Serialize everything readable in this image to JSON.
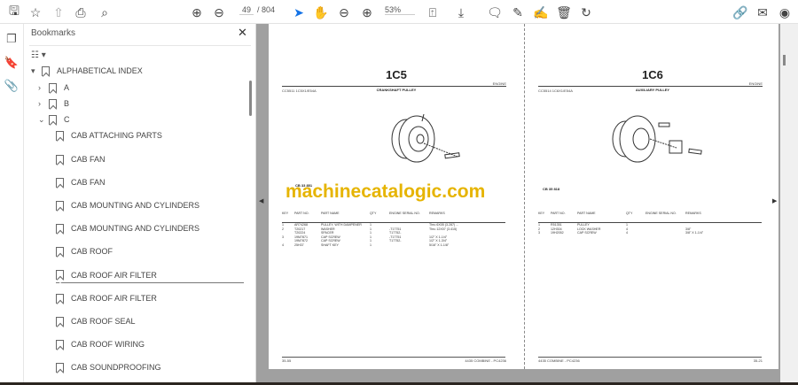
{
  "toolbar": {
    "page_current": "49",
    "page_total": "/ 804",
    "zoom": "53%"
  },
  "bookmarks": {
    "title": "Bookmarks",
    "items": [
      {
        "label": "ALPHABETICAL INDEX",
        "level": 0,
        "expander": "▾"
      },
      {
        "label": "A",
        "level": 1,
        "expander": "›"
      },
      {
        "label": "B",
        "level": 1,
        "expander": "›"
      },
      {
        "label": "C",
        "level": 1,
        "expander": "⌄"
      },
      {
        "label": "CAB ATTACHING PARTS",
        "level": 2
      },
      {
        "label": "CAB FAN",
        "level": 2
      },
      {
        "label": "CAB FAN",
        "level": 2
      },
      {
        "label": "CAB MOUNTING AND CYLINDERS",
        "level": 2
      },
      {
        "label": "CAB MOUNTING AND CYLINDERS",
        "level": 2
      },
      {
        "label": "CAB ROOF",
        "level": 2
      },
      {
        "label": "CAB ROOF AIR FILTER",
        "level": 2
      },
      {
        "label": "CAB ROOF AIR FILTER",
        "level": 2
      },
      {
        "label": "CAB ROOF SEAL",
        "level": 2
      },
      {
        "label": "CAB ROOF WIRING",
        "level": 2
      },
      {
        "label": "CAB SOUNDPROOFING",
        "level": 2
      }
    ]
  },
  "left_page": {
    "title": "1C5",
    "section": "ENGINE",
    "code": "CC5511   1C5X1/E54A",
    "subtitle": "CRANKSHAFT PULLEY",
    "figure": "CB 33 851",
    "headers": [
      "KEY",
      "PART NO.",
      "PART NAME",
      "QTY",
      "ENGINE SERIAL NO.",
      "REMARKS"
    ],
    "rows": [
      [
        "1",
        "AR74268",
        "PULLEY, WITH DAMPENER",
        "1",
        "",
        "Thru 6X05 (3.287) ..."
      ],
      [
        "2",
        "T20217",
        "WASHER",
        "1",
        "-T17751",
        "Thru 12X07 (3.415)"
      ],
      [
        "",
        "T20224",
        "SPACER",
        "1",
        "T17752-",
        ""
      ],
      [
        "3",
        "19M7871",
        "CAP SCREW",
        "1",
        "-T17751",
        "1/2\" X 1-1/4\""
      ],
      [
        "",
        "19M7872",
        "CAP SCREW",
        "1",
        "T17752-",
        "1/2\" X 1-3/4\""
      ],
      [
        "4",
        "25H37",
        "SHAFT KEY",
        "1",
        "",
        "5/16\" X 1-1/8\""
      ]
    ],
    "footer_left": "35-55",
    "footer_right": "4435 COMBINE - PC4236"
  },
  "right_page": {
    "title": "1C6",
    "section": "ENGINE",
    "code": "CC5514   1C6X1/E54A",
    "subtitle": "AUXILIARY PULLEY",
    "figure": "CB 35 818",
    "headers": [
      "KEY",
      "PART NO.",
      "PART NAME",
      "QTY",
      "ENGINE SERIAL NO.",
      "REMARKS"
    ],
    "rows": [
      [
        "1",
        "R51351",
        "PULLEY",
        "1",
        "",
        ""
      ],
      [
        "2",
        "12H304",
        "LOCK WASHER",
        "4",
        "",
        "3/8\""
      ],
      [
        "3",
        "19H2052",
        "CAP SCREW",
        "4",
        "",
        "3/8\" X 1-1/4\""
      ]
    ],
    "footer_left": "4435 COMBINE - PC4236",
    "footer_right": "35-21"
  },
  "watermark": "machinecatalogic.com",
  "colors": {
    "accent": "#1473e6",
    "watermark": "#e6b400"
  }
}
